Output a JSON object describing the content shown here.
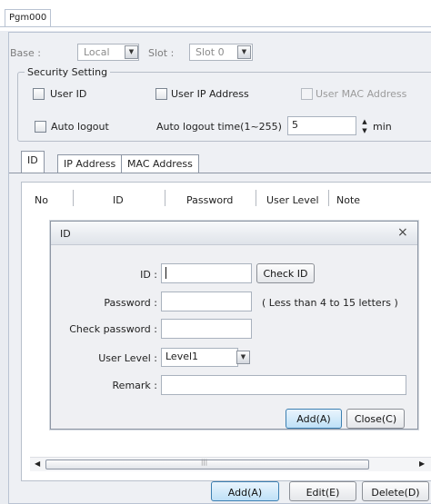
{
  "doc_tab": {
    "label": "Pgm000"
  },
  "base": {
    "label": "Base :",
    "value": "Local"
  },
  "slot": {
    "label": "Slot :",
    "value": "Slot 0"
  },
  "security": {
    "title": "Security Setting",
    "user_id": "User ID",
    "user_ip": "User IP Address",
    "user_mac": "User MAC Address",
    "auto_logout": "Auto logout",
    "auto_logout_time_label": "Auto logout time(1~255)",
    "auto_logout_time_value": "5",
    "min_label": "min"
  },
  "tabs": [
    {
      "label": "ID"
    },
    {
      "label": "IP Address"
    },
    {
      "label": "MAC Address"
    }
  ],
  "columns": [
    "No",
    "ID",
    "Password",
    "User Level",
    "Note"
  ],
  "dialog": {
    "title": "ID",
    "id_label": "ID :",
    "id_value": "",
    "check_id": "Check ID",
    "password_label": "Password :",
    "password_hint": "( Less than 4 to 15 letters )",
    "check_password_label": "Check password :",
    "user_level_label": "User Level :",
    "user_level_value": "Level1",
    "remark_label": "Remark :",
    "add_button": "Add(A)",
    "close_button": "Close(C)"
  },
  "bottom_buttons": {
    "add": "Add(A)",
    "edit": "Edit(E)",
    "delete": "Delete(D)"
  },
  "icons": {
    "close": "close-icon",
    "dropdown": "chevron-down-icon",
    "spin_up": "triangle-up-icon",
    "spin_down": "triangle-down-icon",
    "scroll_left": "triangle-left-icon",
    "scroll_right": "triangle-right-icon"
  }
}
